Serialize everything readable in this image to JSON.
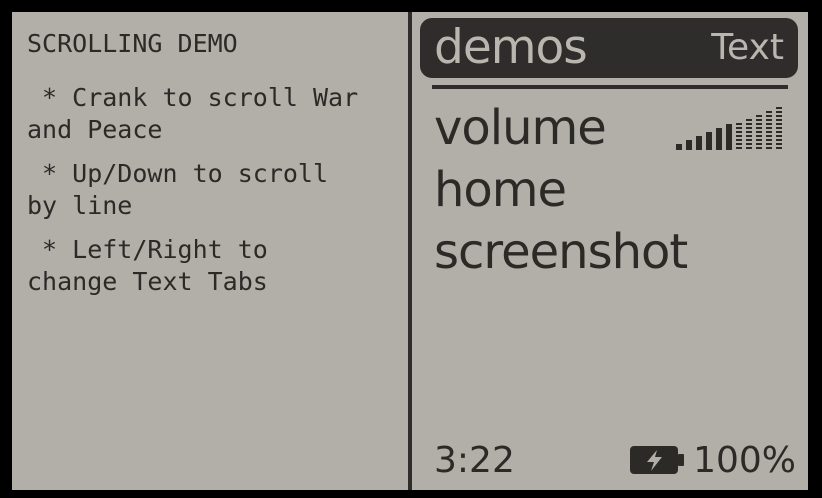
{
  "demo_text": {
    "title": "SCROLLING DEMO",
    "lines": [
      " * Crank to scroll War",
      "and Peace",
      " * Up/Down to scroll",
      "by line",
      " * Left/Right to",
      "change Text Tabs"
    ]
  },
  "menu": {
    "header_title": "demos",
    "header_tab": "Text",
    "items": [
      {
        "label": "volume"
      },
      {
        "label": "home"
      },
      {
        "label": "screenshot"
      }
    ],
    "volume_level": 0.5,
    "volume_icon": "volume-meter-icon"
  },
  "status": {
    "time": "3:22",
    "battery_icon": "battery-charging-icon",
    "battery_percent": "100%"
  },
  "colors": {
    "screen_bg": "#b1afa8",
    "ink": "#2b2a27",
    "header_bg": "#2e2d2b",
    "header_text": "#b8b6ae"
  }
}
